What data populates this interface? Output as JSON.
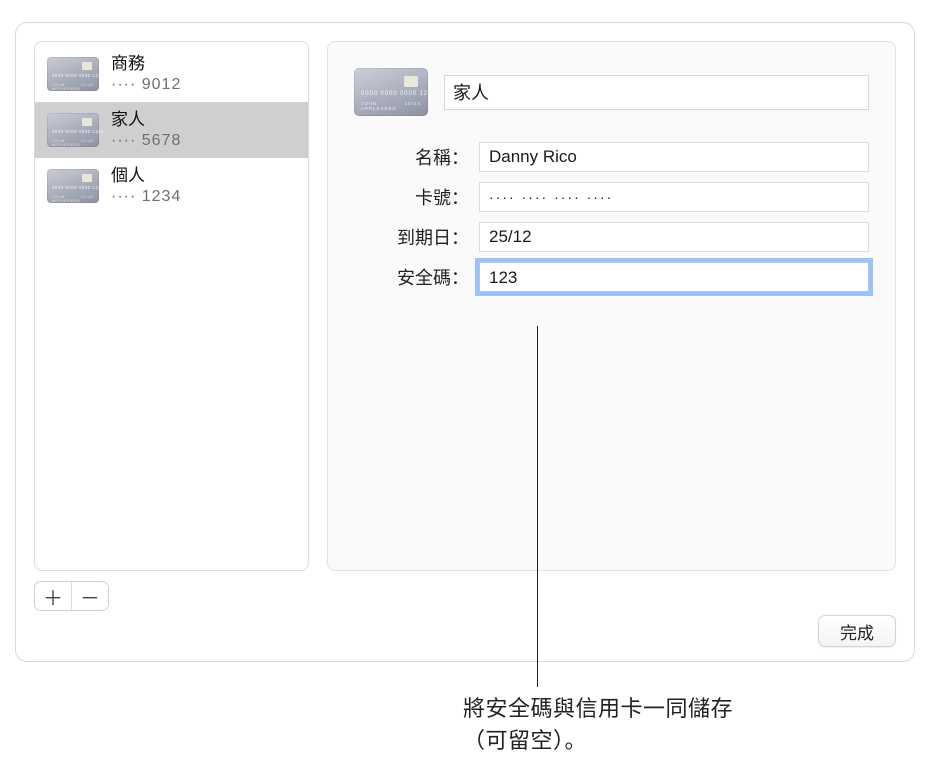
{
  "sidebar": {
    "items": [
      {
        "title": "商務",
        "sub": "···· 9012"
      },
      {
        "title": "家人",
        "sub": "···· 5678"
      },
      {
        "title": "個人",
        "sub": "···· 1234"
      }
    ],
    "selected_index": 1
  },
  "detail": {
    "title_value": "家人",
    "labels": {
      "name": "名稱：",
      "number": "卡號：",
      "expiry": "到期日：",
      "cvv": "安全碼："
    },
    "values": {
      "name": "Danny Rico",
      "number_masked": "···· ···· ···· ····",
      "expiry": "25/12",
      "cvv": "123"
    }
  },
  "buttons": {
    "done": "完成",
    "add_glyph": "＋",
    "remove_glyph": "－"
  },
  "callout": {
    "line1": "將安全碼與信用卡一同儲存",
    "line2": "（可留空）。"
  }
}
